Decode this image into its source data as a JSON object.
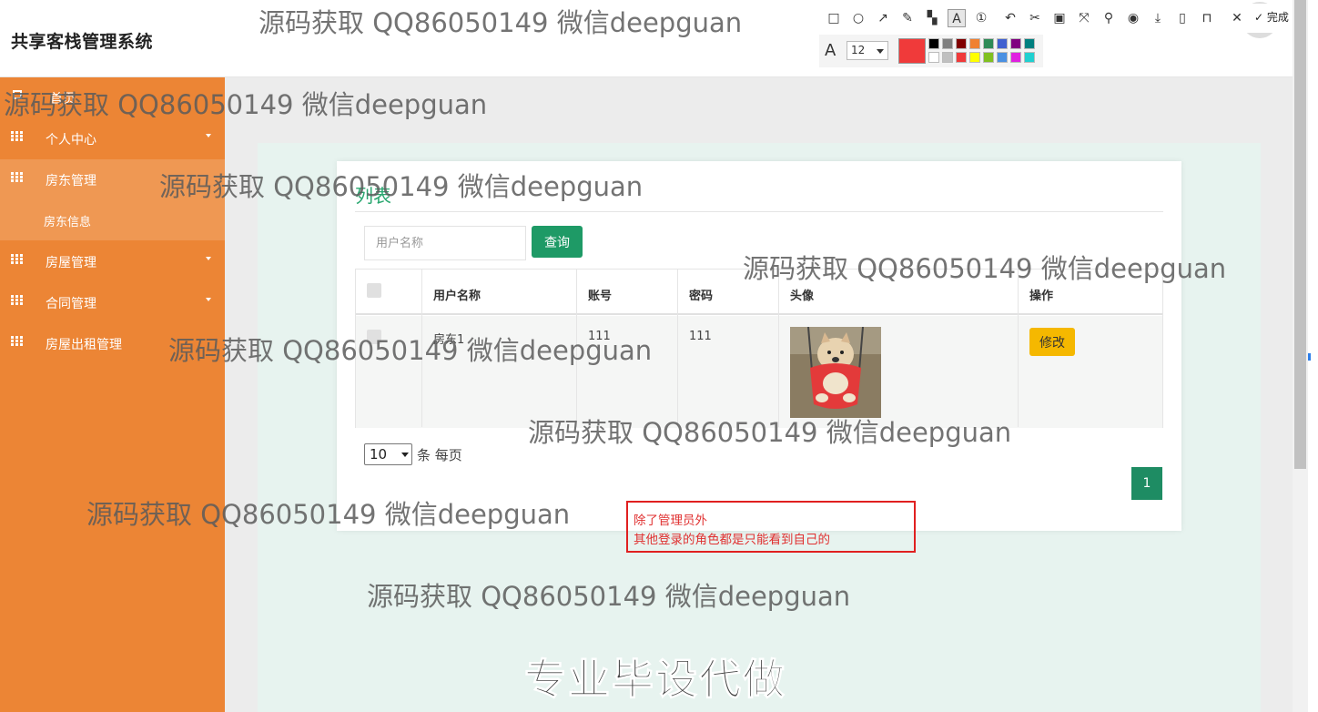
{
  "app": {
    "title": "共享客栈管理系统"
  },
  "sidebar": {
    "items": [
      {
        "label": "首页"
      },
      {
        "label": "个人中心"
      },
      {
        "label": "房东管理",
        "subitems": [
          {
            "label": "房东信息"
          }
        ]
      },
      {
        "label": "房屋管理"
      },
      {
        "label": "合同管理"
      },
      {
        "label": "房屋出租管理"
      }
    ]
  },
  "main": {
    "card_title": "列表",
    "search": {
      "placeholder": "用户名称",
      "button": "查询"
    },
    "table": {
      "headers": [
        "用户名称",
        "账号",
        "密码",
        "头像",
        "操作"
      ],
      "rows": [
        {
          "username": "房东1",
          "account": "111",
          "password": "111",
          "avatar": "shiba-dog-photo",
          "action": "修改"
        }
      ]
    },
    "pagination": {
      "page_size": "10",
      "page_size_label": "条 每页",
      "current_page": "1"
    }
  },
  "annotation": {
    "line1": "除了管理员外",
    "line2": "其他登录的角色都是只能看到自己的",
    "color": "#e03030"
  },
  "toolbar": {
    "done_label": "完成",
    "font_size": "12",
    "current_color": "#f03a3a",
    "palette": [
      "#000000",
      "#808080",
      "#800000",
      "#f08030",
      "#2e8b57",
      "#4060d0",
      "#800080",
      "#008080",
      "#ffffff",
      "#c0c0c0",
      "#f03a3a",
      "#ffff00",
      "#80c020",
      "#4a90e2",
      "#e020e0",
      "#20d0d0"
    ]
  },
  "watermarks": {
    "text": "源码获取 QQ86050149 微信deepguan",
    "big_text": "专业毕设代做"
  },
  "colors": {
    "sidebar": "#ec8535",
    "sidebar_active": "#ef9853",
    "primary": "#1e9a66",
    "edit": "#f5b800",
    "title_green": "#2aa770"
  }
}
